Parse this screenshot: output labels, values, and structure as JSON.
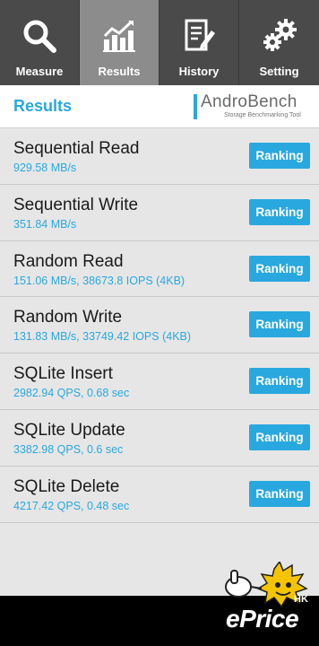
{
  "tabs": [
    {
      "label": "Measure",
      "icon": "search-icon",
      "active": false
    },
    {
      "label": "Results",
      "icon": "chart-icon",
      "active": true
    },
    {
      "label": "History",
      "icon": "document-edit-icon",
      "active": false
    },
    {
      "label": "Setting",
      "icon": "gears-icon",
      "active": false
    }
  ],
  "header": {
    "title": "Results",
    "logo_text": "AndroBench",
    "logo_subtitle": "Storage Benchmarking Tool"
  },
  "results": [
    {
      "name": "Sequential Read",
      "value": "929.58 MB/s",
      "button": "Ranking"
    },
    {
      "name": "Sequential Write",
      "value": "351.84 MB/s",
      "button": "Ranking"
    },
    {
      "name": "Random Read",
      "value": "151.06 MB/s, 38673.8 IOPS (4KB)",
      "button": "Ranking"
    },
    {
      "name": "Random Write",
      "value": "131.83 MB/s, 33749.42 IOPS (4KB)",
      "button": "Ranking"
    },
    {
      "name": "SQLite Insert",
      "value": "2982.94 QPS, 0.68 sec",
      "button": "Ranking"
    },
    {
      "name": "SQLite Update",
      "value": "3382.98 QPS, 0.6 sec",
      "button": "Ranking"
    },
    {
      "name": "SQLite Delete",
      "value": "4217.42 QPS, 0.48 sec",
      "button": "Ranking"
    }
  ],
  "watermark": {
    "text": "ePrice",
    "region": "HK"
  },
  "colors": {
    "accent": "#29a8df",
    "tabbar": "#4a4a4a",
    "tab_active": "#8c8c8c",
    "list_bg": "#e6e6e6"
  }
}
